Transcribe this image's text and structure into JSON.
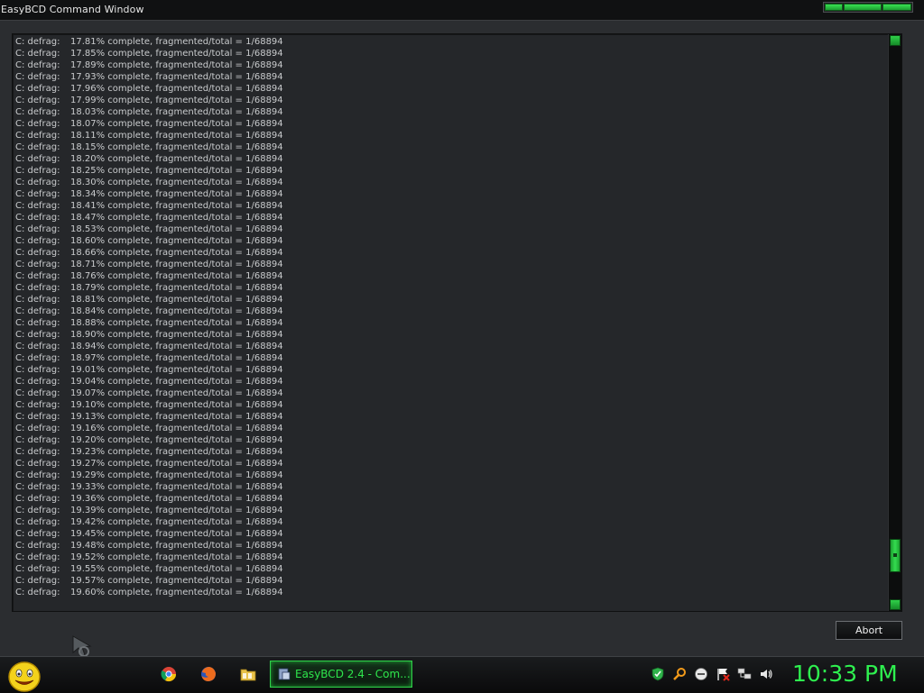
{
  "window": {
    "title": "EasyBCD Command Window"
  },
  "console": {
    "lines": [
      {
        "drive": "C: defrag:",
        "text": "17.81% complete, fragmented/total = 1/68894"
      },
      {
        "drive": "C: defrag:",
        "text": "17.85% complete, fragmented/total = 1/68894"
      },
      {
        "drive": "C: defrag:",
        "text": "17.89% complete, fragmented/total = 1/68894"
      },
      {
        "drive": "C: defrag:",
        "text": "17.93% complete, fragmented/total = 1/68894"
      },
      {
        "drive": "C: defrag:",
        "text": "17.96% complete, fragmented/total = 1/68894"
      },
      {
        "drive": "C: defrag:",
        "text": "17.99% complete, fragmented/total = 1/68894"
      },
      {
        "drive": "C: defrag:",
        "text": "18.03% complete, fragmented/total = 1/68894"
      },
      {
        "drive": "C: defrag:",
        "text": "18.07% complete, fragmented/total = 1/68894"
      },
      {
        "drive": "C: defrag:",
        "text": "18.11% complete, fragmented/total = 1/68894"
      },
      {
        "drive": "C: defrag:",
        "text": "18.15% complete, fragmented/total = 1/68894"
      },
      {
        "drive": "C: defrag:",
        "text": "18.20% complete, fragmented/total = 1/68894"
      },
      {
        "drive": "C: defrag:",
        "text": "18.25% complete, fragmented/total = 1/68894"
      },
      {
        "drive": "C: defrag:",
        "text": "18.30% complete, fragmented/total = 1/68894"
      },
      {
        "drive": "C: defrag:",
        "text": "18.34% complete, fragmented/total = 1/68894"
      },
      {
        "drive": "C: defrag:",
        "text": "18.41% complete, fragmented/total = 1/68894"
      },
      {
        "drive": "C: defrag:",
        "text": "18.47% complete, fragmented/total = 1/68894"
      },
      {
        "drive": "C: defrag:",
        "text": "18.53% complete, fragmented/total = 1/68894"
      },
      {
        "drive": "C: defrag:",
        "text": "18.60% complete, fragmented/total = 1/68894"
      },
      {
        "drive": "C: defrag:",
        "text": "18.66% complete, fragmented/total = 1/68894"
      },
      {
        "drive": "C: defrag:",
        "text": "18.71% complete, fragmented/total = 1/68894"
      },
      {
        "drive": "C: defrag:",
        "text": "18.76% complete, fragmented/total = 1/68894"
      },
      {
        "drive": "C: defrag:",
        "text": "18.79% complete, fragmented/total = 1/68894"
      },
      {
        "drive": "C: defrag:",
        "text": "18.81% complete, fragmented/total = 1/68894"
      },
      {
        "drive": "C: defrag:",
        "text": "18.84% complete, fragmented/total = 1/68894"
      },
      {
        "drive": "C: defrag:",
        "text": "18.88% complete, fragmented/total = 1/68894"
      },
      {
        "drive": "C: defrag:",
        "text": "18.90% complete, fragmented/total = 1/68894"
      },
      {
        "drive": "C: defrag:",
        "text": "18.94% complete, fragmented/total = 1/68894"
      },
      {
        "drive": "C: defrag:",
        "text": "18.97% complete, fragmented/total = 1/68894"
      },
      {
        "drive": "C: defrag:",
        "text": "19.01% complete, fragmented/total = 1/68894"
      },
      {
        "drive": "C: defrag:",
        "text": "19.04% complete, fragmented/total = 1/68894"
      },
      {
        "drive": "C: defrag:",
        "text": "19.07% complete, fragmented/total = 1/68894"
      },
      {
        "drive": "C: defrag:",
        "text": "19.10% complete, fragmented/total = 1/68894"
      },
      {
        "drive": "C: defrag:",
        "text": "19.13% complete, fragmented/total = 1/68894"
      },
      {
        "drive": "C: defrag:",
        "text": "19.16% complete, fragmented/total = 1/68894"
      },
      {
        "drive": "C: defrag:",
        "text": "19.20% complete, fragmented/total = 1/68894"
      },
      {
        "drive": "C: defrag:",
        "text": "19.23% complete, fragmented/total = 1/68894"
      },
      {
        "drive": "C: defrag:",
        "text": "19.27% complete, fragmented/total = 1/68894"
      },
      {
        "drive": "C: defrag:",
        "text": "19.29% complete, fragmented/total = 1/68894"
      },
      {
        "drive": "C: defrag:",
        "text": "19.33% complete, fragmented/total = 1/68894"
      },
      {
        "drive": "C: defrag:",
        "text": "19.36% complete, fragmented/total = 1/68894"
      },
      {
        "drive": "C: defrag:",
        "text": "19.39% complete, fragmented/total = 1/68894"
      },
      {
        "drive": "C: defrag:",
        "text": "19.42% complete, fragmented/total = 1/68894"
      },
      {
        "drive": "C: defrag:",
        "text": "19.45% complete, fragmented/total = 1/68894"
      },
      {
        "drive": "C: defrag:",
        "text": "19.48% complete, fragmented/total = 1/68894"
      },
      {
        "drive": "C: defrag:",
        "text": "19.52% complete, fragmented/total = 1/68894"
      },
      {
        "drive": "C: defrag:",
        "text": "19.55% complete, fragmented/total = 1/68894"
      },
      {
        "drive": "C: defrag:",
        "text": "19.57% complete, fragmented/total = 1/68894"
      },
      {
        "drive": "C: defrag:",
        "text": "19.60% complete, fragmented/total = 1/68894"
      }
    ],
    "scroll_position": 0.95
  },
  "abort_button": {
    "label": "Abort"
  },
  "taskbar": {
    "start_icon": "smiley-start-icon",
    "pinned": [
      {
        "name": "chrome-icon"
      },
      {
        "name": "firefox-icon"
      },
      {
        "name": "folder-icon"
      }
    ],
    "active_task": {
      "label": "EasyBCD 2.4 - Com...",
      "icon": "easybcd-icon"
    },
    "tray": [
      {
        "name": "shield-icon"
      },
      {
        "name": "magnifier-icon"
      },
      {
        "name": "messenger-icon"
      },
      {
        "name": "flag-icon"
      },
      {
        "name": "network-icon"
      },
      {
        "name": "volume-icon"
      }
    ],
    "clock": "10:33 PM"
  },
  "colors": {
    "accent_green": "#2ef04f",
    "background": "#2b2d30",
    "console_bg": "#25272a",
    "console_text": "#c9cbcd"
  }
}
